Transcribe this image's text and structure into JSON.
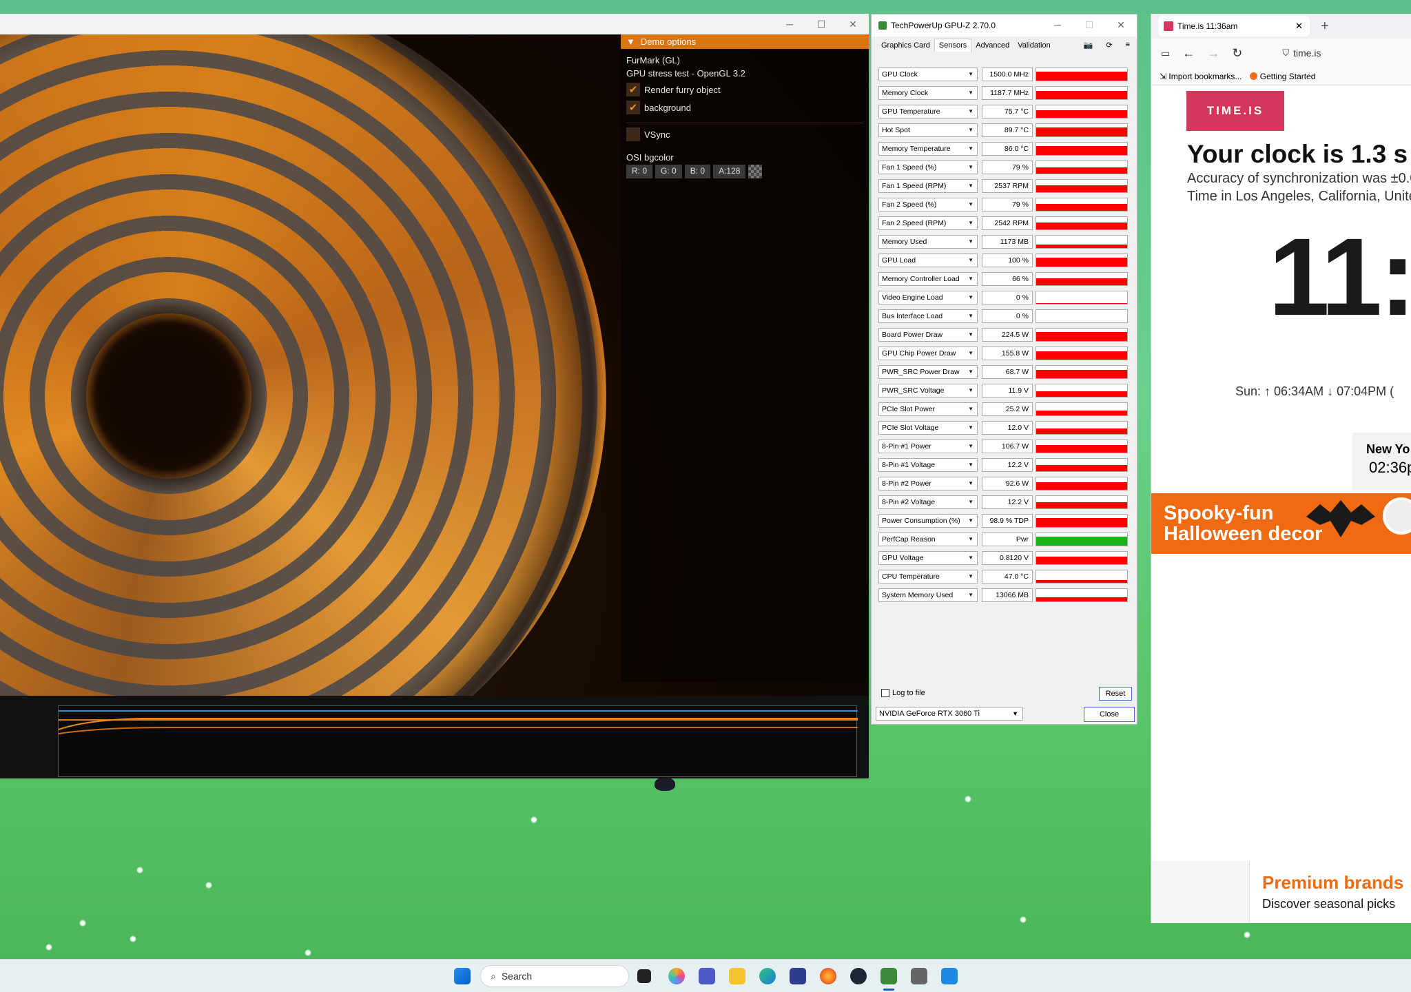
{
  "furmark": {
    "panel_header": "Demo options",
    "app_name": "FurMark (GL)",
    "subtitle": "GPU stress test - OpenGL 3.2",
    "check_render": "Render furry object",
    "check_background": "background",
    "check_vsync": "VSync",
    "osi_label": "OSI bgcolor",
    "r": "R: 0",
    "g": "G: 0",
    "b": "B: 0",
    "a": "A:128"
  },
  "gpuz": {
    "title": "TechPowerUp GPU-Z 2.70.0",
    "tabs": [
      "Graphics Card",
      "Sensors",
      "Advanced",
      "Validation"
    ],
    "active_tab": "Sensors",
    "sensors": [
      {
        "name": "GPU Clock",
        "value": "1500.0 MHz",
        "level": 0.7,
        "color": "#ff0000"
      },
      {
        "name": "Memory Clock",
        "value": "1187.7 MHz",
        "level": 0.65,
        "color": "#ff0000"
      },
      {
        "name": "GPU Temperature",
        "value": "75.7 °C",
        "level": 0.6,
        "color": "#ff0000"
      },
      {
        "name": "Hot Spot",
        "value": "89.7 °C",
        "level": 0.7,
        "color": "#ff0000"
      },
      {
        "name": "Memory Temperature",
        "value": "86.0 °C",
        "level": 0.7,
        "color": "#ff0000"
      },
      {
        "name": "Fan 1 Speed (%)",
        "value": "79 %",
        "level": 0.5,
        "color": "#ff0000"
      },
      {
        "name": "Fan 1 Speed (RPM)",
        "value": "2537 RPM",
        "level": 0.55,
        "color": "#ff0000"
      },
      {
        "name": "Fan 2 Speed (%)",
        "value": "79 %",
        "level": 0.55,
        "color": "#ff0000"
      },
      {
        "name": "Fan 2 Speed (RPM)",
        "value": "2542 RPM",
        "level": 0.55,
        "color": "#ff0000"
      },
      {
        "name": "Memory Used",
        "value": "1173 MB",
        "level": 0.3,
        "color": "#ff0000"
      },
      {
        "name": "GPU Load",
        "value": "100 %",
        "level": 0.75,
        "color": "#ff0000"
      },
      {
        "name": "Memory Controller Load",
        "value": "66 %",
        "level": 0.55,
        "color": "#ff0000"
      },
      {
        "name": "Video Engine Load",
        "value": "0 %",
        "level": 0.03,
        "color": "#ff0000"
      },
      {
        "name": "Bus Interface Load",
        "value": "0 %",
        "level": 0.0,
        "color": "#ff0000"
      },
      {
        "name": "Board Power Draw",
        "value": "224.5 W",
        "level": 0.7,
        "color": "#ff0000"
      },
      {
        "name": "GPU Chip Power Draw",
        "value": "155.8 W",
        "level": 0.65,
        "color": "#ff0000"
      },
      {
        "name": "PWR_SRC Power Draw",
        "value": "68.7 W",
        "level": 0.65,
        "color": "#ff0000"
      },
      {
        "name": "PWR_SRC Voltage",
        "value": "11.9 V",
        "level": 0.45,
        "color": "#ff0000"
      },
      {
        "name": "PCIe Slot Power",
        "value": "25.2 W",
        "level": 0.4,
        "color": "#ff0000"
      },
      {
        "name": "PCIe Slot Voltage",
        "value": "12.0 V",
        "level": 0.45,
        "color": "#ff0000"
      },
      {
        "name": "8-Pin #1 Power",
        "value": "106.7 W",
        "level": 0.6,
        "color": "#ff0000"
      },
      {
        "name": "8-Pin #1 Voltage",
        "value": "12.2 V",
        "level": 0.5,
        "color": "#ff0000"
      },
      {
        "name": "8-Pin #2 Power",
        "value": "92.6 W",
        "level": 0.6,
        "color": "#ff0000"
      },
      {
        "name": "8-Pin #2 Voltage",
        "value": "12.2 V",
        "level": 0.5,
        "color": "#ff0000"
      },
      {
        "name": "Power Consumption (%)",
        "value": "98.9 % TDP",
        "level": 0.7,
        "color": "#ff0000"
      },
      {
        "name": "PerfCap Reason",
        "value": "Pwr",
        "level": 0.75,
        "color": "#18b418"
      },
      {
        "name": "GPU Voltage",
        "value": "0.8120 V",
        "level": 0.6,
        "color": "#ff0000"
      },
      {
        "name": "CPU Temperature",
        "value": "47.0 °C",
        "level": 0.2,
        "color": "#ff0000"
      },
      {
        "name": "System Memory Used",
        "value": "13066 MB",
        "level": 0.35,
        "color": "#ff0000"
      }
    ],
    "log_to_file": "Log to file",
    "reset": "Reset",
    "gpu_select": "NVIDIA GeForce RTX 3060 Ti",
    "close": "Close"
  },
  "browser": {
    "tab_title": "Time.is 11:36am",
    "url": "time.is",
    "bookmarks": [
      "Import bookmarks...",
      "Getting Started"
    ],
    "brand": "TIME.IS",
    "headline": "Your clock is 1.3 s",
    "accuracy": "Accuracy of synchronization was ±0.0",
    "location": "Time in Los Angeles, California, Unite",
    "big_time": "11:",
    "sun": "Sun: ↑ 06:34AM ↓ 07:04PM (",
    "ny_city": "New Yo",
    "ny_time": "02:36p",
    "ad_line1": "Spooky-fun",
    "ad_line2": "Halloween decor",
    "premium_title": "Premium brands",
    "premium_sub": "Discover seasonal picks"
  },
  "taskbar": {
    "search_placeholder": "Search"
  }
}
